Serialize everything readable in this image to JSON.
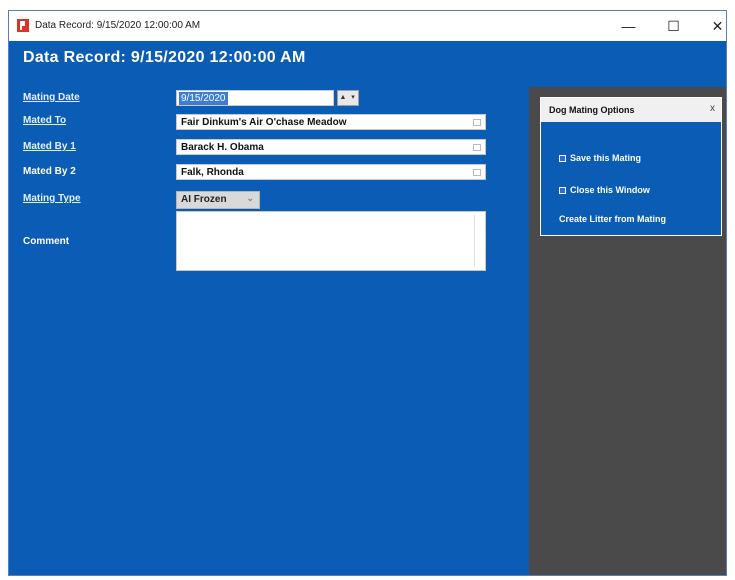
{
  "window": {
    "title": "Data Record: 9/15/2020 12:00:00 AM",
    "controls": {
      "minimize": "—",
      "maximize": "☐",
      "close": "✕"
    }
  },
  "header": {
    "title": "Data Record: 9/15/2020 12:00:00 AM"
  },
  "form": {
    "mating_date": {
      "label": "Mating Date",
      "value": "9/15/2020"
    },
    "mated_to": {
      "label": "Mated To",
      "value": "Fair Dinkum's Air O'chase Meadow"
    },
    "mated_by_1": {
      "label": "Mated By 1",
      "value": "Barack H. Obama"
    },
    "mated_by_2": {
      "label": "Mated By 2",
      "value": "Falk, Rhonda"
    },
    "mating_type": {
      "label": "Mating Type",
      "value": "AI Frozen"
    },
    "comment": {
      "label": "Comment",
      "value": ""
    }
  },
  "options_panel": {
    "title": "Dog Mating Options",
    "close": "x",
    "items": [
      {
        "label": "Save this Mating"
      },
      {
        "label": "Close this Window"
      },
      {
        "label": "Create Litter from Mating"
      }
    ]
  },
  "colors": {
    "background": "#0a5cb5",
    "side": "#4a4a4a",
    "app_icon": "#e0302a"
  },
  "icons": {
    "app": "app-logo-icon",
    "lookup": "lookup-icon",
    "dropdown": "chevron-down-icon"
  }
}
